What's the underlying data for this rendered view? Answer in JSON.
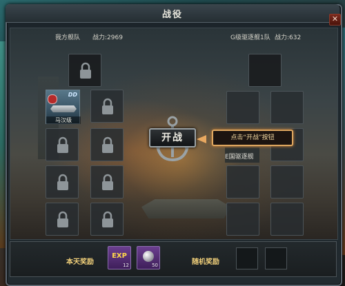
{
  "window": {
    "title": "战役",
    "close_glyph": "✕"
  },
  "my_fleet": {
    "label": "我方舰队",
    "power": "战力:2969"
  },
  "enemy_fleet": {
    "label": "G级驱逐舰1队",
    "power": "战力:632"
  },
  "ship": {
    "class": "DD",
    "name": "马汉级"
  },
  "battle_button": {
    "label": "开战"
  },
  "tooltip": {
    "text": "点击“开战”按钮"
  },
  "enemy_ship_label": "E国驱逐舰",
  "rewards": {
    "today_label": "本天奖励",
    "random_label": "随机奖励",
    "items": [
      {
        "name": "EXP",
        "count": "12"
      },
      {
        "name": "silver-orb",
        "count": "50"
      }
    ]
  },
  "icons": [
    "lock-icon",
    "anchor-icon",
    "arrow-left-icon",
    "close-icon",
    "silver-orb-icon"
  ]
}
